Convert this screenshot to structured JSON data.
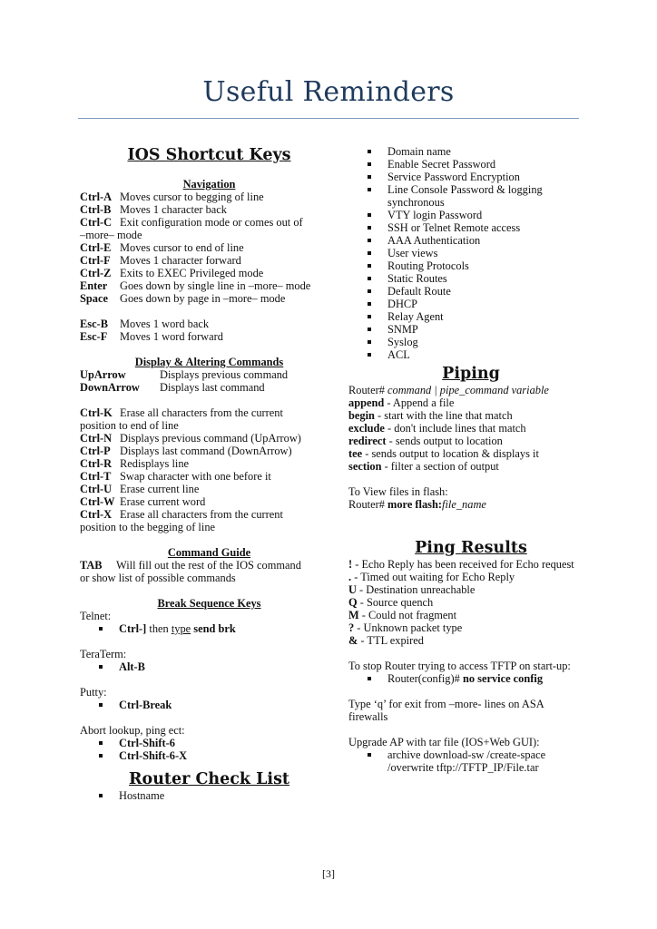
{
  "page_title": "Useful Reminders",
  "ios_shortcut_keys": {
    "heading": "IOS Shortcut Keys",
    "navigation": {
      "heading": "Navigation",
      "items": [
        {
          "key": "Ctrl-A",
          "desc": "Moves cursor to begging of line"
        },
        {
          "key": "Ctrl-B",
          "desc": "Moves 1 character back"
        },
        {
          "key": "Ctrl-C",
          "desc": "Exit configuration mode or comes out of",
          "cont": "–more– mode"
        },
        {
          "key": "Ctrl-E",
          "desc": "Moves cursor to end of line"
        },
        {
          "key": "Ctrl-F",
          "desc": "Moves 1 character forward"
        },
        {
          "key": "Ctrl-Z",
          "desc": "Exits to EXEC Privileged mode"
        },
        {
          "key": "Enter",
          "desc": "Goes down by single line in –more– mode"
        },
        {
          "key": "Space",
          "desc": "Goes down by page in –more– mode"
        }
      ],
      "items2": [
        {
          "key": "Esc-B",
          "desc": "Moves 1 word back"
        },
        {
          "key": "Esc-F",
          "desc": "Moves 1 word forward"
        }
      ]
    },
    "display_altering": {
      "heading": "Display & Altering Commands",
      "arrows": [
        {
          "key": "UpArrow",
          "desc": "Displays previous command"
        },
        {
          "key": "DownArrow",
          "desc": "Displays last command"
        }
      ],
      "items": [
        {
          "key": "Ctrl-K",
          "desc": "Erase all characters from the current",
          "cont": "position to end of line"
        },
        {
          "key": "Ctrl-N",
          "desc": "Displays previous command (UpArrow)"
        },
        {
          "key": "Ctrl-P",
          "desc": "Displays last command (DownArrow)"
        },
        {
          "key": "Ctrl-R",
          "desc": "Redisplays line"
        },
        {
          "key": "Ctrl-T",
          "desc": "Swap character with one before it"
        },
        {
          "key": "Ctrl-U",
          "desc": "Erase current line"
        },
        {
          "key": "Ctrl-W",
          "desc": "Erase current word"
        },
        {
          "key": "Ctrl-X",
          "desc": "Erase all characters from the current",
          "cont": "position to the begging of line"
        }
      ]
    },
    "command_guide": {
      "heading": "Command Guide",
      "key": "TAB",
      "desc": "Will fill out the rest of the IOS command",
      "cont": "or show list of possible commands"
    },
    "break_sequence": {
      "heading": "Break Sequence Keys",
      "telnet_label": "Telnet:",
      "telnet_key": "Ctrl-]",
      "telnet_then": " then ",
      "telnet_type": "type",
      "telnet_cmd": " send brk",
      "teraterm_label": "TeraTerm:",
      "teraterm_key": "Alt-B",
      "putty_label": "Putty:",
      "putty_key": "Ctrl-Break",
      "abort_label": "Abort lookup, ping  ect:",
      "abort_keys": [
        "Ctrl-Shift-6",
        "Ctrl-Shift-6-X"
      ]
    }
  },
  "router_check_list": {
    "heading": "Router Check List",
    "items": [
      "Hostname",
      "Domain name",
      "Enable Secret Password",
      "Service Password Encryption",
      "Line Console Password & logging synchronous",
      "VTY login Password",
      "SSH or Telnet Remote access",
      "AAA Authentication",
      "User views",
      "Routing Protocols",
      "Static Routes",
      "Default Route",
      "DHCP",
      "Relay Agent",
      "SNMP",
      "Syslog",
      "ACL"
    ]
  },
  "piping": {
    "heading": "Piping",
    "syntax_prefix": "Router# ",
    "syntax_italic": "command | pipe_command variable",
    "items": [
      {
        "cmd": "append",
        "desc": " - Append a file"
      },
      {
        "cmd": "begin",
        "desc": " - start with the line that match"
      },
      {
        "cmd": "exclude",
        "desc": " - don't include lines that match"
      },
      {
        "cmd": "redirect",
        "desc": " - sends output to location"
      },
      {
        "cmd": "tee",
        "desc": " - sends output to location & displays it"
      },
      {
        "cmd": "section",
        "desc": " - filter a section of output"
      }
    ],
    "flash_label": "To View files in flash:",
    "flash_prefix": "Router# ",
    "flash_cmd": "more flash:",
    "flash_var": "file_name"
  },
  "ping_results": {
    "heading": "Ping Results",
    "items": [
      {
        "sym": "!",
        "desc": " - Echo Reply has been received for Echo request"
      },
      {
        "sym": ".",
        "desc": " - Timed out waiting for Echo Reply"
      },
      {
        "sym": "U",
        "desc": " - Destination unreachable"
      },
      {
        "sym": "Q",
        "desc": " - Source quench"
      },
      {
        "sym": "M",
        "desc": " - Could not fragment"
      },
      {
        "sym": "?",
        "desc": " - Unknown packet type"
      },
      {
        "sym": "&",
        "desc": " - TTL expired"
      }
    ],
    "tftp_label": "To stop Router trying to access TFTP on start-up:",
    "tftp_prefix": "Router(config)# ",
    "tftp_cmd": "no service config",
    "asa_note": "Type ‘q’ for exit from –more- lines on ASA firewalls",
    "upgrade_label": "Upgrade AP with tar file (IOS+Web GUI):",
    "upgrade_cmd": "archive download-sw /create-space /overwrite tftp://TFTP_IP/File.tar"
  },
  "page_number": "[3]"
}
